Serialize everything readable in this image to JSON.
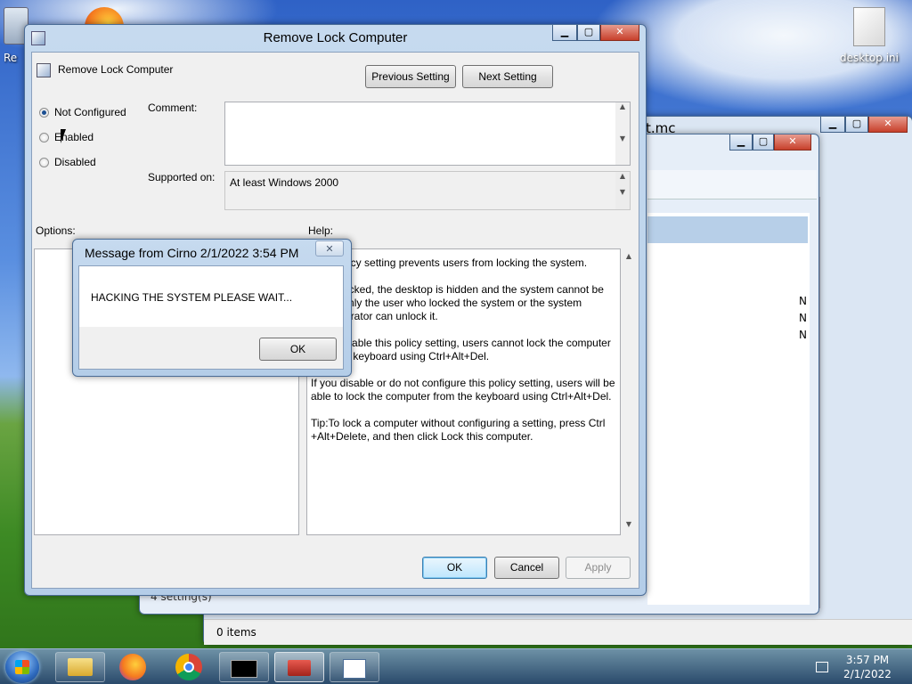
{
  "desktop": {
    "icon_right_label": "desktop.ini",
    "icon_left_label": "Re"
  },
  "back_window": {
    "title_fragment": "t.mc",
    "status": "0 items",
    "status_left": "4 setting(s)",
    "list_items": [
      "N",
      "N",
      "N"
    ]
  },
  "policy_dialog": {
    "title": "Remove Lock Computer",
    "header_label": "Remove Lock Computer",
    "prev_button": "Previous Setting",
    "next_button": "Next Setting",
    "options": [
      {
        "label": "Not Configured",
        "selected": true
      },
      {
        "label": "Enabled",
        "selected": false
      },
      {
        "label": "Disabled",
        "selected": false
      }
    ],
    "comment_label": "Comment:",
    "supported_label": "Supported on:",
    "supported_value": "At least Windows 2000",
    "options_label": "Options:",
    "help_label": "Help:",
    "help_paragraphs": [
      "This policy setting prevents users from locking the system.",
      "While locked, the desktop is hidden and the system cannot be used. Only the user who locked the system or the system administrator can unlock it.",
      "If you enable this policy setting, users cannot lock the computer from the keyboard using Ctrl+Alt+Del.",
      "If you disable or do not configure this policy setting, users will be able to lock the computer from the keyboard using Ctrl+Alt+Del.",
      "Tip:To lock a computer without configuring a setting, press Ctrl +Alt+Delete, and then click Lock this computer."
    ],
    "ok_button": "OK",
    "cancel_button": "Cancel",
    "apply_button": "Apply"
  },
  "message_box": {
    "title": "Message from Cirno 2/1/2022 3:54 PM",
    "message": "HACKING THE SYSTEM PLEASE WAIT...",
    "ok_button": "OK",
    "close_glyph": "✕"
  },
  "taskbar": {
    "time": "3:57 PM",
    "date": "2/1/2022"
  },
  "colors": {
    "title_bar": "#b4cde8",
    "dialog_face": "#f0f0f0",
    "default_button": "#bee6fd"
  }
}
